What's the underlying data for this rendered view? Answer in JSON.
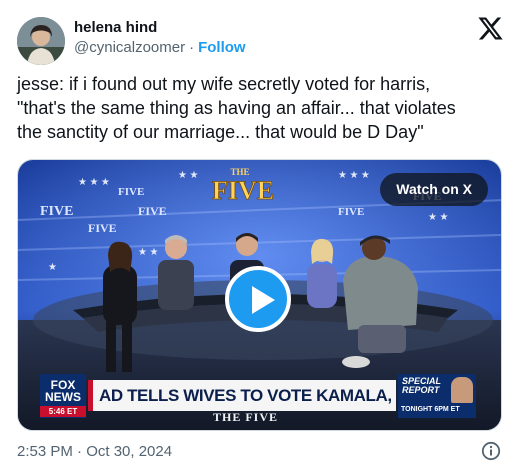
{
  "author": {
    "name": "helena hind",
    "handle": "@cynicalzoomer",
    "separator": "·",
    "follow_label": "Follow"
  },
  "icons": {
    "x_logo": "x-logo-icon",
    "play": "play-icon",
    "info": "info-icon"
  },
  "tweet": {
    "text": "jesse: if i found out my wife secretly voted for harris,\n\"that's the same thing as having an affair... that violates\nthe sanctity of our marriage... that would be D Day\""
  },
  "media": {
    "watch_label": "Watch on X",
    "show_logo": "THE FIVE",
    "side_logo": "FIVE",
    "network": "FOX",
    "network_sub": "NEWS",
    "air_time": "5:46 ET",
    "headline": "AD TELLS WIVES TO VOTE KAMALA, LIE TO THEIR SPOUSE",
    "promo_title": "SPECIAL REPORT",
    "promo_sub": "TONIGHT 6PM ET",
    "bug": "THE FIVE"
  },
  "footer": {
    "timestamp": "2:53 PM · Oct 30, 2024"
  },
  "colors": {
    "accent": "#1d9bf0",
    "text_primary": "#0f1419",
    "text_secondary": "#536471",
    "fox_red": "#c8102e",
    "fox_blue": "#0b2d6b"
  }
}
